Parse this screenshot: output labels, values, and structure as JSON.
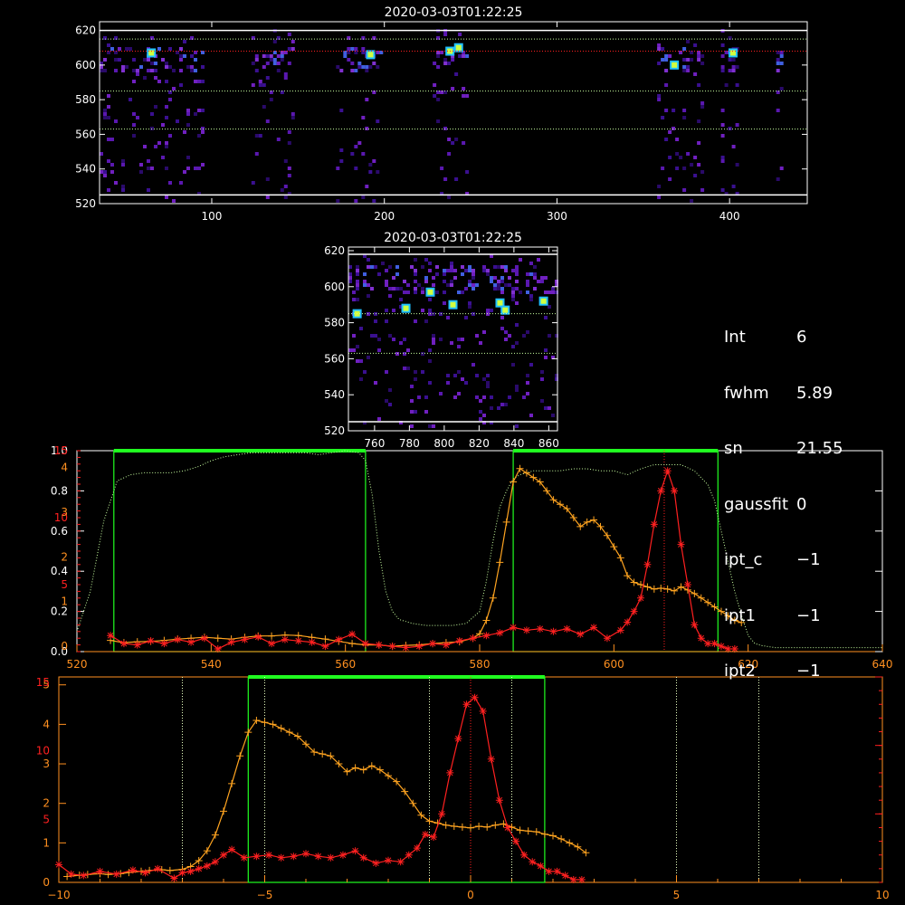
{
  "colors": {
    "background": "#000000",
    "axis": "#ffffff",
    "orange_series": "#ffa420",
    "red_series": "#ff2020",
    "green_window": "#20ff20",
    "green_curve": "#c8ffa0",
    "red_axis": "#ff2020",
    "orange_axis": "#ff9020"
  },
  "info_panel": [
    {
      "key": "Int",
      "value": "6"
    },
    {
      "key": "fwhm",
      "value": "5.89"
    },
    {
      "key": "sn",
      "value": "21.55"
    },
    {
      "key": "gaussfit",
      "value": "0"
    },
    {
      "key": "ipt_c",
      "value": "−1"
    },
    {
      "key": "ipt1",
      "value": "−1"
    },
    {
      "key": "ipt2",
      "value": "−1"
    }
  ],
  "chart_data": [
    {
      "id": "top_image",
      "type": "heatmap",
      "title": "2020-03-03T01:22:25",
      "xlim": [
        35,
        445
      ],
      "ylim": [
        520,
        625
      ],
      "xticks": [
        100,
        200,
        300,
        400
      ],
      "yticks": [
        520,
        540,
        560,
        580,
        600,
        620
      ],
      "hlines_white": [
        525,
        620
      ],
      "hlines_green": [
        563,
        585,
        615
      ],
      "hlines_red": [
        608
      ],
      "columns": [
        [
          35,
          95
        ],
        [
          123,
          148
        ],
        [
          172,
          198
        ],
        [
          228,
          248
        ],
        [
          358,
          385
        ],
        [
          395,
          405
        ],
        [
          427,
          431
        ]
      ],
      "bright_spots": [
        [
          238,
          608
        ],
        [
          243,
          610
        ],
        [
          402,
          607
        ],
        [
          368,
          600
        ],
        [
          65,
          607
        ],
        [
          192,
          606
        ]
      ]
    },
    {
      "id": "zoom_image",
      "type": "heatmap",
      "title": "2020-03-03T01:22:25",
      "xlim": [
        745,
        865
      ],
      "ylim": [
        520,
        622
      ],
      "xticks": [
        760,
        780,
        800,
        820,
        840,
        860
      ],
      "yticks": [
        520,
        540,
        560,
        580,
        600,
        620
      ],
      "hlines_white": [
        525,
        618
      ],
      "hlines_green": [
        563,
        585
      ],
      "bright_spots": [
        [
          750,
          585
        ],
        [
          778,
          588
        ],
        [
          792,
          597
        ],
        [
          805,
          590
        ],
        [
          832,
          591
        ],
        [
          835,
          587
        ],
        [
          857,
          592
        ]
      ]
    },
    {
      "id": "spectrum_plot",
      "type": "line",
      "xlim": [
        520,
        640
      ],
      "xticks": [
        520,
        540,
        560,
        580,
        600,
        620,
        640
      ],
      "left_axis_ticks": [
        "0.0",
        "0.2",
        "0.4",
        "0.6",
        "0.8",
        "1.0"
      ],
      "left_axis_red_ticks": [
        "5",
        "10",
        "15"
      ],
      "orange_axis_ticks": [
        "0",
        "1",
        "2",
        "3",
        "4"
      ],
      "green_windows": [
        [
          525.5,
          563
        ],
        [
          585,
          615.5
        ]
      ],
      "red_vline": 607.5,
      "series": [
        {
          "color_key": "orange_series",
          "x": [
            525,
            527,
            529,
            531,
            533,
            535,
            537,
            539,
            541,
            543,
            545,
            547,
            549,
            551,
            553,
            555,
            557,
            559,
            561,
            563,
            565,
            567,
            569,
            571,
            573,
            575,
            577,
            579,
            580,
            581,
            582,
            583,
            584,
            585,
            586,
            587,
            588,
            589,
            590,
            591,
            592,
            593,
            594,
            595,
            596,
            597,
            598,
            599,
            600,
            601,
            602,
            603,
            604,
            605,
            606,
            607,
            608,
            609,
            610,
            611,
            612,
            613,
            614,
            615,
            616,
            617,
            618,
            619
          ],
          "values": [
            0.25,
            0.2,
            0.22,
            0.23,
            0.25,
            0.28,
            0.3,
            0.32,
            0.3,
            0.28,
            0.32,
            0.35,
            0.35,
            0.37,
            0.36,
            0.32,
            0.28,
            0.23,
            0.18,
            0.15,
            0.15,
            0.12,
            0.14,
            0.15,
            0.18,
            0.2,
            0.22,
            0.3,
            0.4,
            0.7,
            1.2,
            2.0,
            2.9,
            3.8,
            4.1,
            4.0,
            3.9,
            3.8,
            3.6,
            3.4,
            3.3,
            3.2,
            3.0,
            2.8,
            2.9,
            2.95,
            2.8,
            2.6,
            2.35,
            2.1,
            1.7,
            1.55,
            1.5,
            1.45,
            1.4,
            1.42,
            1.4,
            1.36,
            1.45,
            1.38,
            1.3,
            1.2,
            1.1,
            1.0,
            0.9,
            0.8,
            0.7,
            0.65
          ]
        },
        {
          "color_key": "red_series",
          "x": [
            525,
            527,
            529,
            531,
            533,
            535,
            537,
            539,
            541,
            543,
            545,
            547,
            549,
            551,
            553,
            555,
            557,
            559,
            561,
            563,
            565,
            567,
            569,
            571,
            573,
            575,
            577,
            579,
            581,
            583,
            585,
            587,
            589,
            591,
            593,
            595,
            597,
            599,
            601,
            602,
            603,
            604,
            605,
            606,
            607,
            608,
            609,
            610,
            611,
            612,
            613,
            614,
            615,
            616,
            617,
            618
          ],
          "values": [
            1.2,
            0.6,
            0.5,
            0.8,
            0.6,
            0.9,
            0.7,
            1.0,
            0.2,
            0.7,
            0.9,
            1.1,
            0.6,
            0.9,
            0.8,
            0.7,
            0.4,
            0.9,
            1.3,
            0.6,
            0.5,
            0.4,
            0.3,
            0.4,
            0.6,
            0.5,
            0.8,
            1.0,
            1.2,
            1.4,
            1.8,
            1.6,
            1.7,
            1.5,
            1.7,
            1.3,
            1.8,
            1.0,
            1.6,
            2.2,
            3.0,
            4.0,
            6.5,
            9.5,
            12.0,
            13.5,
            12.0,
            8.0,
            5.0,
            2.0,
            1.0,
            0.6,
            0.6,
            0.4,
            0.2,
            0.2
          ]
        },
        {
          "color_key": "green_curve",
          "x": [
            520,
            522,
            524,
            526,
            528,
            530,
            532,
            534,
            536,
            538,
            540,
            542,
            544,
            546,
            548,
            550,
            552,
            554,
            556,
            558,
            560,
            562,
            563,
            564,
            565,
            566,
            567,
            568,
            570,
            572,
            574,
            576,
            578,
            580,
            581,
            582,
            583,
            584,
            585,
            586,
            588,
            590,
            592,
            594,
            596,
            598,
            600,
            602,
            604,
            606,
            608,
            610,
            612,
            614,
            615,
            616,
            617,
            618,
            619,
            620,
            621,
            622,
            624,
            626,
            630,
            635,
            640
          ],
          "values": [
            0.1,
            0.3,
            0.65,
            0.85,
            0.88,
            0.89,
            0.89,
            0.89,
            0.9,
            0.92,
            0.95,
            0.97,
            0.98,
            0.99,
            0.99,
            0.99,
            0.99,
            0.99,
            0.98,
            0.99,
            1.0,
            0.99,
            0.95,
            0.78,
            0.5,
            0.3,
            0.2,
            0.16,
            0.14,
            0.13,
            0.13,
            0.13,
            0.14,
            0.2,
            0.35,
            0.55,
            0.72,
            0.8,
            0.86,
            0.88,
            0.9,
            0.9,
            0.9,
            0.91,
            0.91,
            0.9,
            0.9,
            0.88,
            0.91,
            0.93,
            0.93,
            0.93,
            0.9,
            0.83,
            0.75,
            0.6,
            0.45,
            0.3,
            0.18,
            0.08,
            0.04,
            0.03,
            0.02,
            0.02,
            0.02,
            0.02,
            0.02
          ]
        }
      ]
    },
    {
      "id": "velocity_plot",
      "type": "line",
      "xlim": [
        -10,
        10
      ],
      "xticks": [
        -10,
        -5,
        0,
        5,
        10
      ],
      "left_axis_orange_ticks": [
        "0",
        "1",
        "2",
        "3",
        "4",
        "5"
      ],
      "left_axis_red_ticks": [
        "5",
        "10",
        "15"
      ],
      "green_window": [
        -5.4,
        1.8
      ],
      "red_vline": 0,
      "dotted_vlines": [
        -7,
        -5,
        -1,
        1,
        5,
        7
      ],
      "series": [
        {
          "color_key": "orange_series",
          "x": [
            -9.8,
            -9.5,
            -9.3,
            -9.0,
            -8.8,
            -8.5,
            -8.3,
            -8.0,
            -7.8,
            -7.5,
            -7.3,
            -7.0,
            -6.8,
            -6.6,
            -6.4,
            -6.2,
            -6.0,
            -5.8,
            -5.6,
            -5.4,
            -5.2,
            -5.0,
            -4.8,
            -4.6,
            -4.4,
            -4.2,
            -4.0,
            -3.8,
            -3.6,
            -3.4,
            -3.2,
            -3.0,
            -2.8,
            -2.6,
            -2.4,
            -2.2,
            -2.0,
            -1.8,
            -1.6,
            -1.4,
            -1.2,
            -1.0,
            -0.8,
            -0.6,
            -0.4,
            -0.2,
            0.0,
            0.2,
            0.4,
            0.6,
            0.8,
            1.0,
            1.2,
            1.4,
            1.6,
            1.8,
            2.0,
            2.2,
            2.4,
            2.6,
            2.8
          ],
          "values": [
            0.15,
            0.18,
            0.2,
            0.22,
            0.2,
            0.22,
            0.25,
            0.28,
            0.3,
            0.32,
            0.3,
            0.33,
            0.4,
            0.55,
            0.8,
            1.2,
            1.8,
            2.5,
            3.2,
            3.8,
            4.1,
            4.05,
            4.0,
            3.9,
            3.8,
            3.7,
            3.5,
            3.3,
            3.25,
            3.2,
            3.0,
            2.8,
            2.9,
            2.85,
            2.95,
            2.85,
            2.7,
            2.55,
            2.3,
            2.0,
            1.7,
            1.55,
            1.5,
            1.45,
            1.42,
            1.4,
            1.38,
            1.42,
            1.4,
            1.45,
            1.48,
            1.4,
            1.32,
            1.3,
            1.28,
            1.22,
            1.18,
            1.1,
            1.0,
            0.9,
            0.75
          ]
        },
        {
          "color_key": "red_series",
          "x": [
            -10.0,
            -9.7,
            -9.4,
            -9.0,
            -8.6,
            -8.2,
            -7.9,
            -7.6,
            -7.2,
            -7.0,
            -6.8,
            -6.6,
            -6.4,
            -6.2,
            -6.0,
            -5.8,
            -5.5,
            -5.2,
            -4.9,
            -4.6,
            -4.3,
            -4.0,
            -3.7,
            -3.4,
            -3.1,
            -2.8,
            -2.6,
            -2.3,
            -2.0,
            -1.7,
            -1.5,
            -1.3,
            -1.1,
            -0.9,
            -0.7,
            -0.5,
            -0.3,
            -0.1,
            0.1,
            0.3,
            0.5,
            0.7,
            0.9,
            1.1,
            1.3,
            1.5,
            1.7,
            1.9,
            2.1,
            2.3,
            2.5,
            2.7
          ],
          "values": [
            1.3,
            0.6,
            0.5,
            0.8,
            0.6,
            0.9,
            0.7,
            1.0,
            0.3,
            0.7,
            0.8,
            1.0,
            1.2,
            1.5,
            2.0,
            2.4,
            1.8,
            1.9,
            2.0,
            1.8,
            1.9,
            2.1,
            1.9,
            1.8,
            2.0,
            2.3,
            1.8,
            1.4,
            1.6,
            1.5,
            2.0,
            2.5,
            3.5,
            3.3,
            5.0,
            8.0,
            10.5,
            13.0,
            13.5,
            12.5,
            9.0,
            6.0,
            4.0,
            3.0,
            2.0,
            1.5,
            1.2,
            0.8,
            0.8,
            0.5,
            0.2,
            0.2
          ]
        }
      ]
    }
  ]
}
